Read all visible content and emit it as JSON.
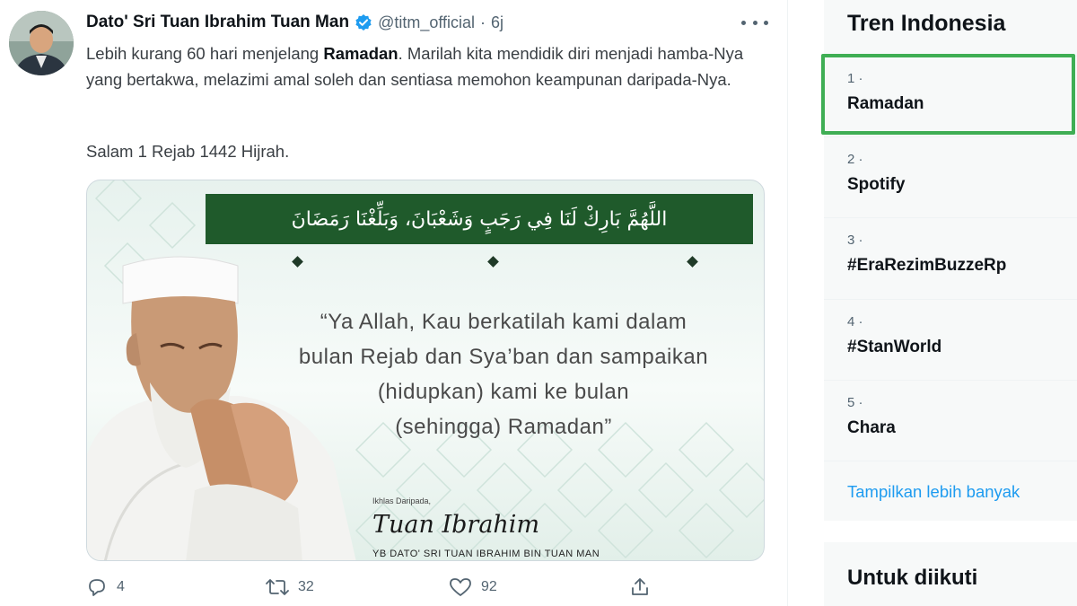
{
  "tweet": {
    "author_name": "Dato' Sri Tuan Ibrahim Tuan Man",
    "handle": "@titm_official",
    "separator": "·",
    "time": "6j",
    "text_before": "Lebih kurang 60 hari menjelang ",
    "text_bold": "Ramadan",
    "text_after": ". Marilah kita mendidik diri menjadi hamba-Nya yang bertakwa, melazimi amal soleh dan sentiasa memohon keampunan daripada-Nya.",
    "salam": "Salam 1 Rejab 1442 Hijrah.",
    "media": {
      "arabic": "اللَّهُمَّ بَارِكْ لَنَا فِي رَجَبٍ وَشَعْبَانَ، وَبَلِّغْنَا رَمَضَانَ",
      "quote_lines": [
        "“Ya Allah, Kau berkatilah kami dalam",
        "bulan Rejab dan Sya’ban dan sampaikan",
        "(hidupkan) kami ke bulan",
        "(sehingga) Ramadan”"
      ],
      "ikhlas": "Ikhlas Daripada,",
      "signature": "Tuan Ibrahim",
      "signature_caption": "YB DATO' SRI TUAN IBRAHIM BIN TUAN MAN"
    },
    "actions": {
      "replies": "4",
      "retweets": "32",
      "likes": "92"
    }
  },
  "sidebar": {
    "title": "Tren Indonesia",
    "trends": [
      {
        "rank": "1 ·",
        "name": "Ramadan"
      },
      {
        "rank": "2 ·",
        "name": "Spotify"
      },
      {
        "rank": "3 ·",
        "name": "#EraRezimBuzzeRp"
      },
      {
        "rank": "4 ·",
        "name": "#StanWorld"
      },
      {
        "rank": "5 ·",
        "name": "Chara"
      }
    ],
    "show_more": "Tampilkan lebih banyak",
    "follow_title": "Untuk diikuti"
  },
  "colors": {
    "accent": "#1d9bf0",
    "highlight": "#3fae54",
    "banner": "#1f5a2b",
    "muted": "#536471"
  },
  "icons": [
    "verified-badge-icon",
    "more-icon",
    "reply-icon",
    "retweet-icon",
    "like-icon",
    "share-icon"
  ]
}
